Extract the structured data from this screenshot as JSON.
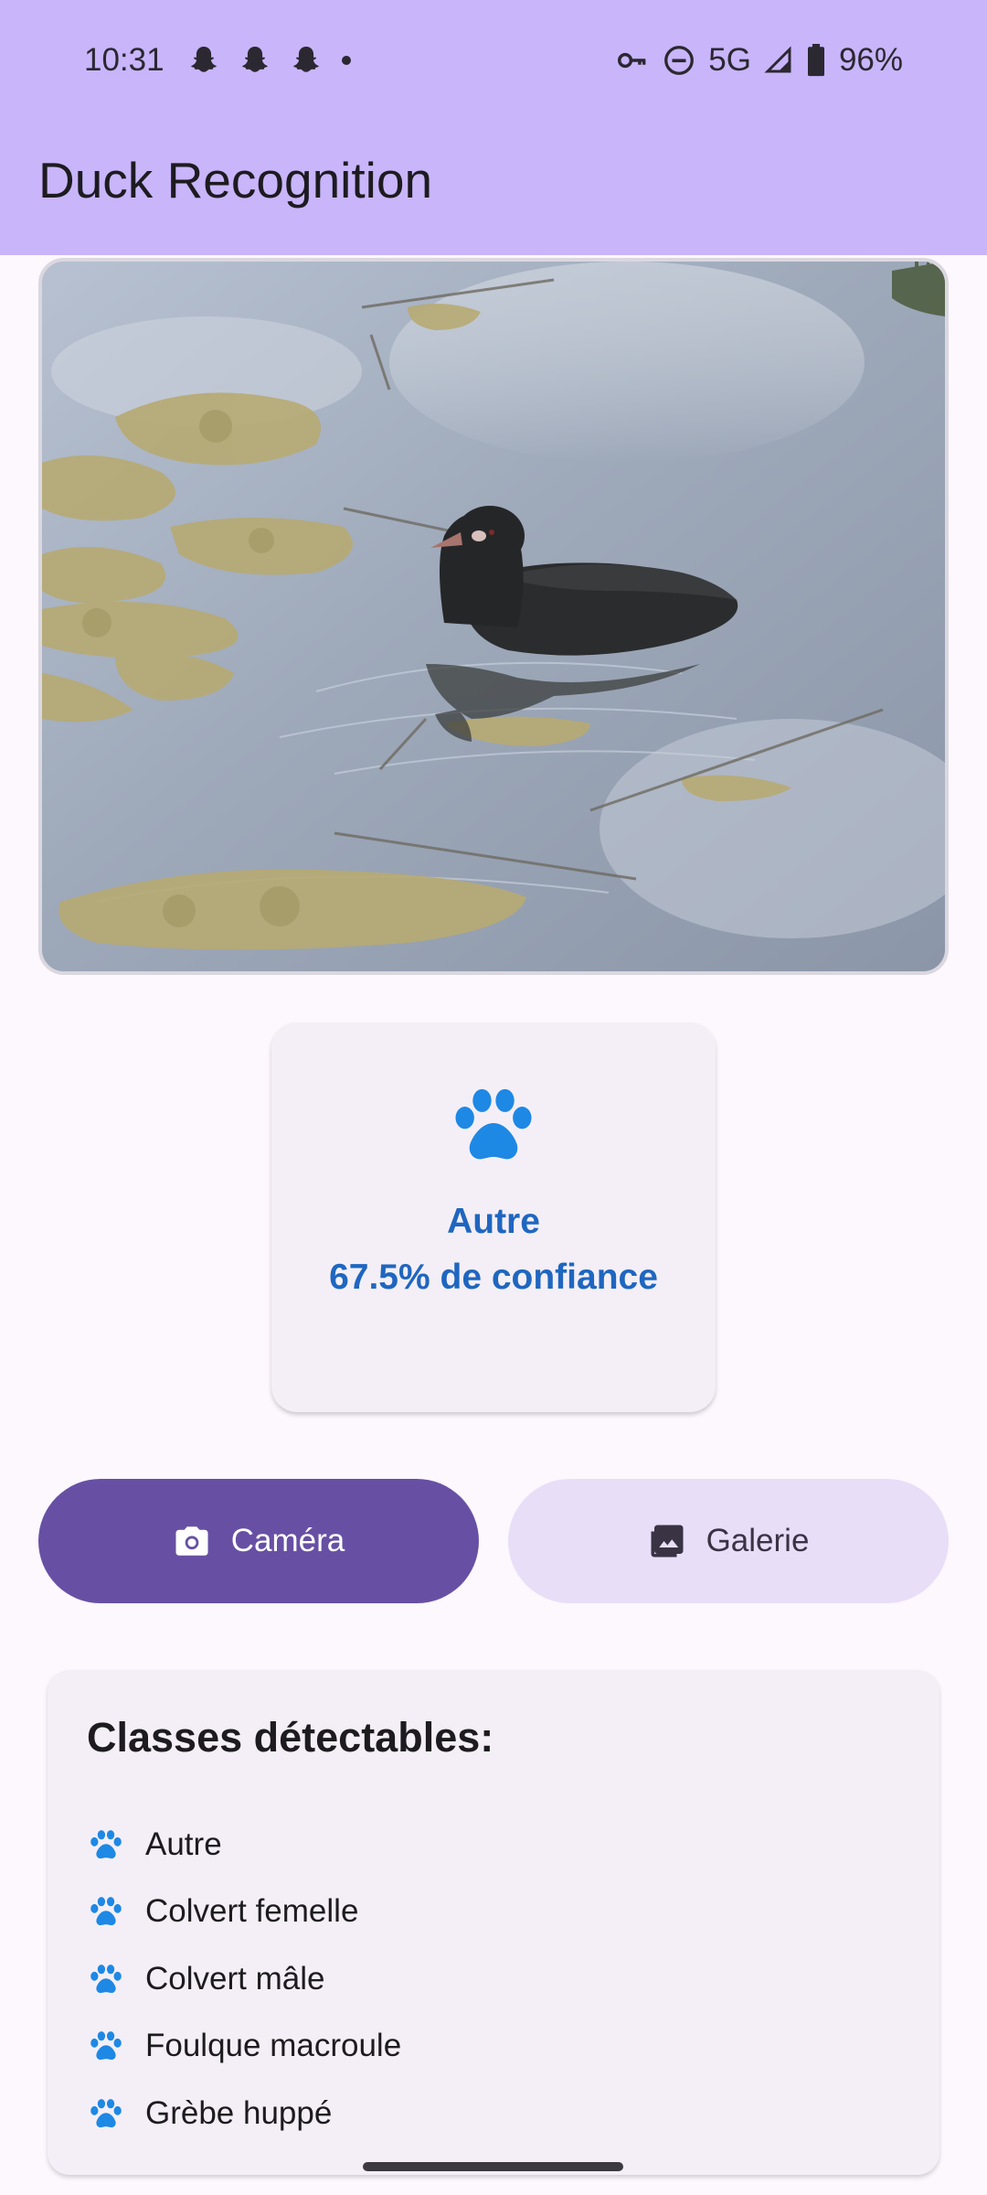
{
  "status_bar": {
    "time": "10:31",
    "network": "5G",
    "battery": "96%",
    "notification_icons": [
      "snapchat-icon",
      "snapchat-icon",
      "snapchat-icon",
      "dot-icon"
    ],
    "system_icons": [
      "vpn-key-icon",
      "do-not-disturb-icon",
      "signal-icon",
      "battery-icon"
    ]
  },
  "app_bar": {
    "title": "Duck Recognition"
  },
  "photo": {
    "subject": "coot-on-pond"
  },
  "result": {
    "icon": "paw-icon",
    "label": "Autre",
    "confidence_text": "67.5% de confiance",
    "confidence": 67.5,
    "color": "#1f66c0"
  },
  "actions": {
    "camera_label": "Caméra",
    "camera_icon": "camera-icon",
    "gallery_label": "Galerie",
    "gallery_icon": "gallery-icon"
  },
  "classes": {
    "title": "Classes détectables:",
    "items": [
      {
        "label": "Autre",
        "icon": "paw-icon"
      },
      {
        "label": "Colvert femelle",
        "icon": "paw-icon"
      },
      {
        "label": "Colvert mâle",
        "icon": "paw-icon"
      },
      {
        "label": "Foulque macroule",
        "icon": "paw-icon"
      },
      {
        "label": "Grèbe huppé",
        "icon": "paw-icon"
      }
    ]
  },
  "colors": {
    "app_bar": "#c9b5fa",
    "background": "#fdf7fe",
    "primary": "#6750a4",
    "secondary_container": "#e8def8",
    "accent_blue": "#1e88e5"
  }
}
